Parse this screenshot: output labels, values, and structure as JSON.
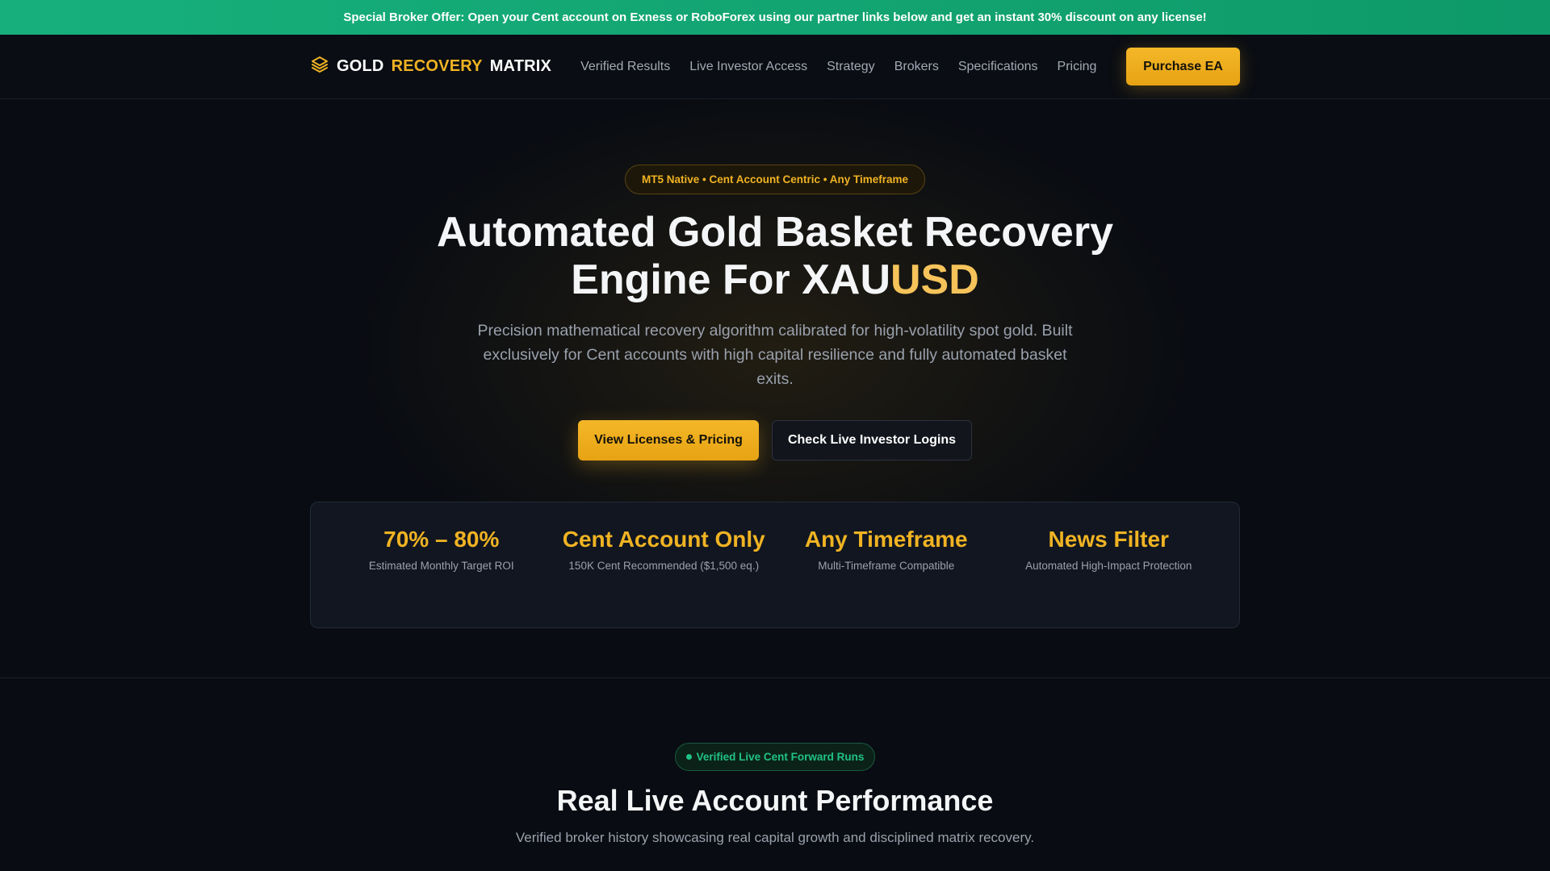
{
  "promo": {
    "text": "Special Broker Offer: Open your Cent account on Exness or RoboForex using our partner links below and get an instant 30% discount on any license!"
  },
  "nav": {
    "logo_icon": "layers-icon",
    "logo_word1": "GOLD",
    "logo_word2": "RECOVERY",
    "logo_word3": "MATRIX",
    "links": [
      "Verified Results",
      "Live Investor Access",
      "Strategy",
      "Brokers",
      "Specifications",
      "Pricing"
    ],
    "cta_label": "Purchase EA"
  },
  "hero": {
    "pill": "MT5 Native • Cent Account Centric • Any Timeframe",
    "title_line1": "Automated Gold Basket Recovery",
    "title_line2_prefix": "Engine For XAU",
    "title_line2_accent": "USD",
    "subtitle": "Precision mathematical recovery algorithm calibrated for high-volatility spot gold. Built exclusively for Cent accounts with high capital resilience and fully automated basket exits.",
    "primary_cta": "View Licenses & Pricing",
    "secondary_cta": "Check Live Investor Logins"
  },
  "stats": [
    {
      "value": "70% – 80%",
      "label": "Estimated Monthly Target ROI"
    },
    {
      "value": "Cent Account Only",
      "label": "150K Cent Recommended ($1,500 eq.)"
    },
    {
      "value": "Any Timeframe",
      "label": "Multi-Timeframe Compatible"
    },
    {
      "value": "News Filter",
      "label": "Automated High-Impact Protection"
    }
  ],
  "live_section": {
    "pill": "Verified Live Cent Forward Runs",
    "title": "Real Live Account Performance",
    "subtitle": "Verified broker history showcasing real capital growth and disciplined matrix recovery."
  },
  "colors": {
    "accent_gold": "#f0b323",
    "promo_green": "#17b07c",
    "verified_green": "#20c283",
    "background": "#090c12"
  }
}
